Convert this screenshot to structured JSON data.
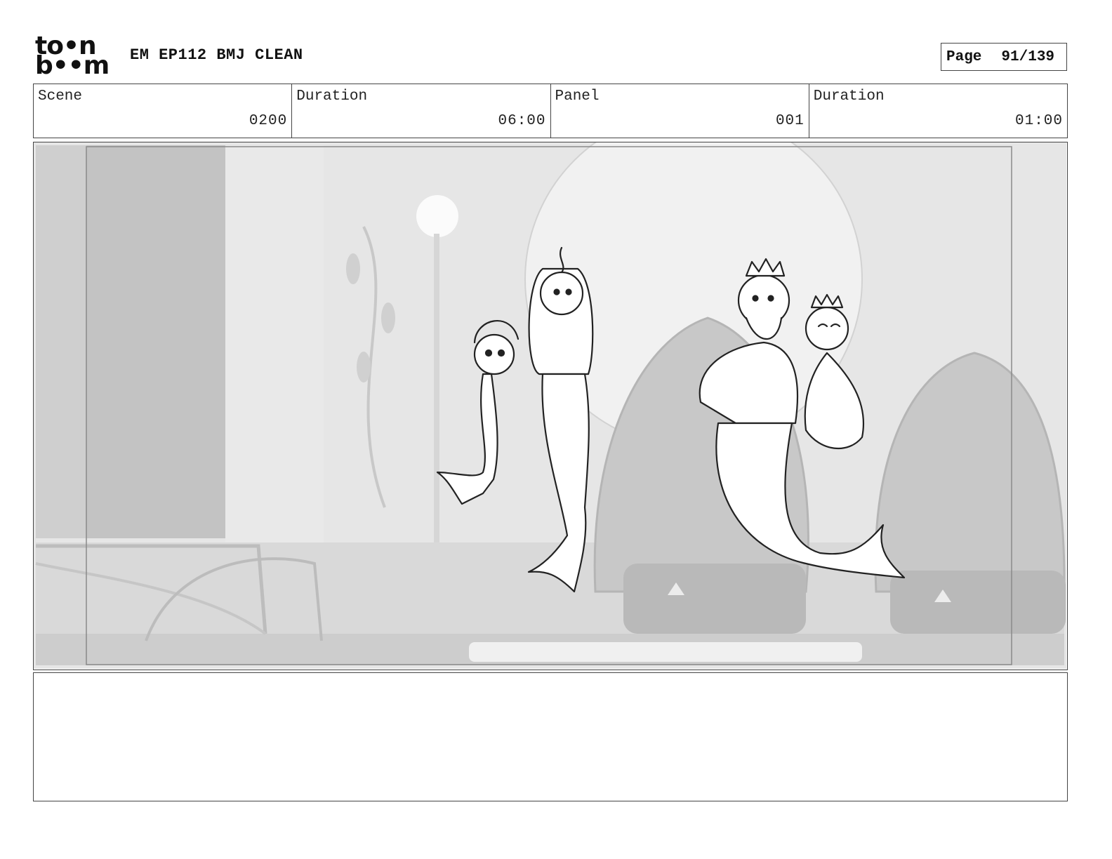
{
  "header": {
    "logo": {
      "line1": "to•n",
      "line2": "b••m",
      "name": "toonboom-logo"
    },
    "title": "EM EP112 BMJ CLEAN",
    "page_label": "Page",
    "page_value": "91/139"
  },
  "info": {
    "scene_label": "Scene",
    "scene_value": "0200",
    "duration_label": "Duration",
    "duration_value": "06:00",
    "panel_label": "Panel",
    "panel_value": "001",
    "panel_duration_label": "Duration",
    "panel_duration_value": "01:00"
  },
  "notes": {
    "text": ""
  }
}
